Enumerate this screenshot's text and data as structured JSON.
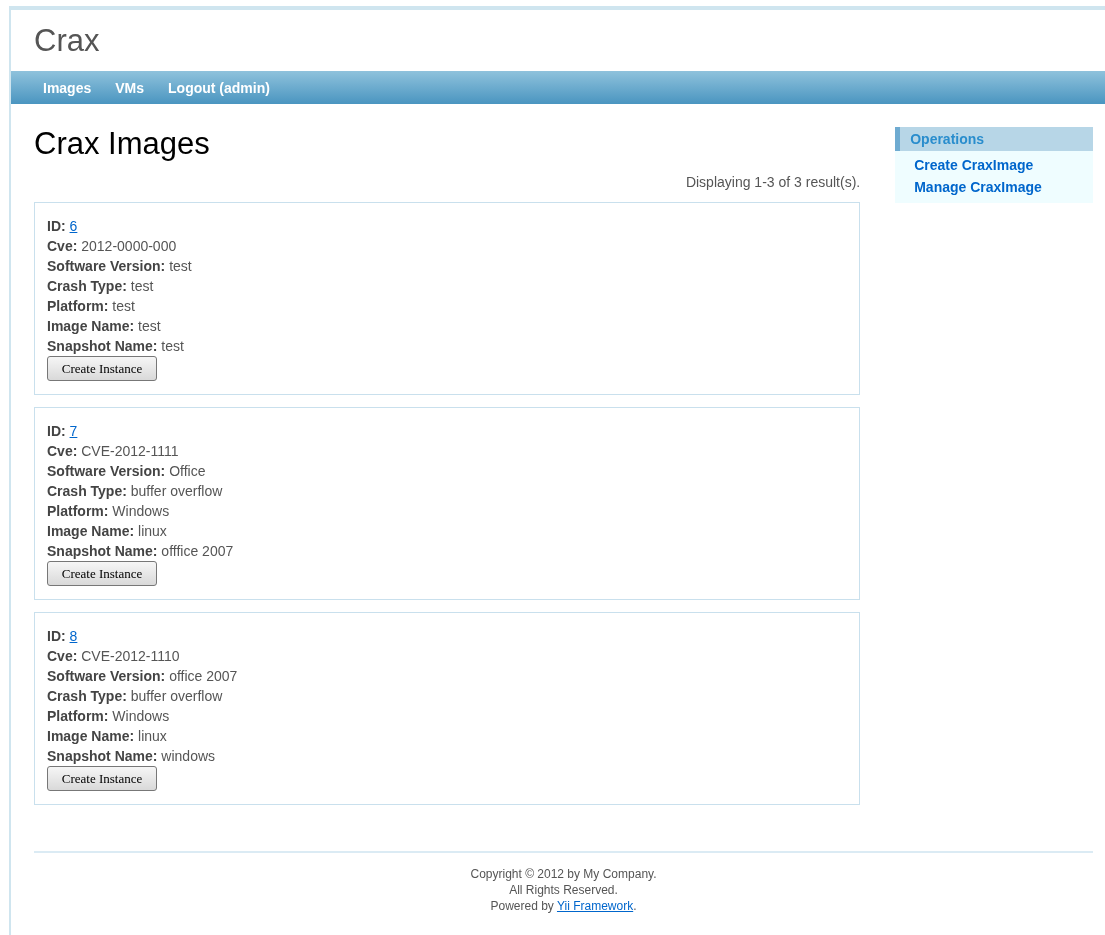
{
  "site": {
    "title": "Crax"
  },
  "menu": [
    {
      "label": "Images"
    },
    {
      "label": "VMs"
    },
    {
      "label": "Logout (admin)"
    }
  ],
  "page": {
    "heading": "Crax Images",
    "summary": "Displaying 1-3 of 3 result(s).",
    "items": [
      {
        "fields": [
          {
            "kind": "link",
            "label": "ID:",
            "value": "6"
          },
          {
            "kind": "text",
            "label": "Cve:",
            "value": "2012-0000-000"
          },
          {
            "kind": "text",
            "label": "Software Version:",
            "value": "test"
          },
          {
            "kind": "text",
            "label": "Crash Type:",
            "value": "test"
          },
          {
            "kind": "text",
            "label": "Platform:",
            "value": "test"
          },
          {
            "kind": "text",
            "label": "Image Name:",
            "value": "test"
          },
          {
            "kind": "text",
            "label": "Snapshot Name:",
            "value": "test"
          }
        ],
        "button": "Create Instance"
      },
      {
        "fields": [
          {
            "kind": "link",
            "label": "ID:",
            "value": "7"
          },
          {
            "kind": "text",
            "label": "Cve:",
            "value": "CVE-2012-1111"
          },
          {
            "kind": "text",
            "label": "Software Version:",
            "value": "Office"
          },
          {
            "kind": "text",
            "label": "Crash Type:",
            "value": "buffer overflow"
          },
          {
            "kind": "text",
            "label": "Platform:",
            "value": "Windows"
          },
          {
            "kind": "text",
            "label": "Image Name:",
            "value": "linux"
          },
          {
            "kind": "text",
            "label": "Snapshot Name:",
            "value": "offfice 2007"
          }
        ],
        "button": "Create Instance"
      },
      {
        "fields": [
          {
            "kind": "link",
            "label": "ID:",
            "value": "8"
          },
          {
            "kind": "text",
            "label": "Cve:",
            "value": "CVE-2012-1110"
          },
          {
            "kind": "text",
            "label": "Software Version:",
            "value": "office 2007"
          },
          {
            "kind": "text",
            "label": "Crash Type:",
            "value": "buffer overflow"
          },
          {
            "kind": "text",
            "label": "Platform:",
            "value": "Windows"
          },
          {
            "kind": "text",
            "label": "Image Name:",
            "value": "linux"
          },
          {
            "kind": "text",
            "label": "Snapshot Name:",
            "value": "windows"
          }
        ],
        "button": "Create Instance"
      }
    ]
  },
  "sidebar": {
    "title": "Operations",
    "items": [
      {
        "label": "Create CraxImage"
      },
      {
        "label": "Manage CraxImage"
      }
    ]
  },
  "footer": {
    "lines": [
      "Copyright © 2012 by My Company.",
      "All Rights Reserved."
    ],
    "powered": {
      "prefix": "Powered by ",
      "link": "Yii Framework",
      "suffix": "."
    }
  }
}
